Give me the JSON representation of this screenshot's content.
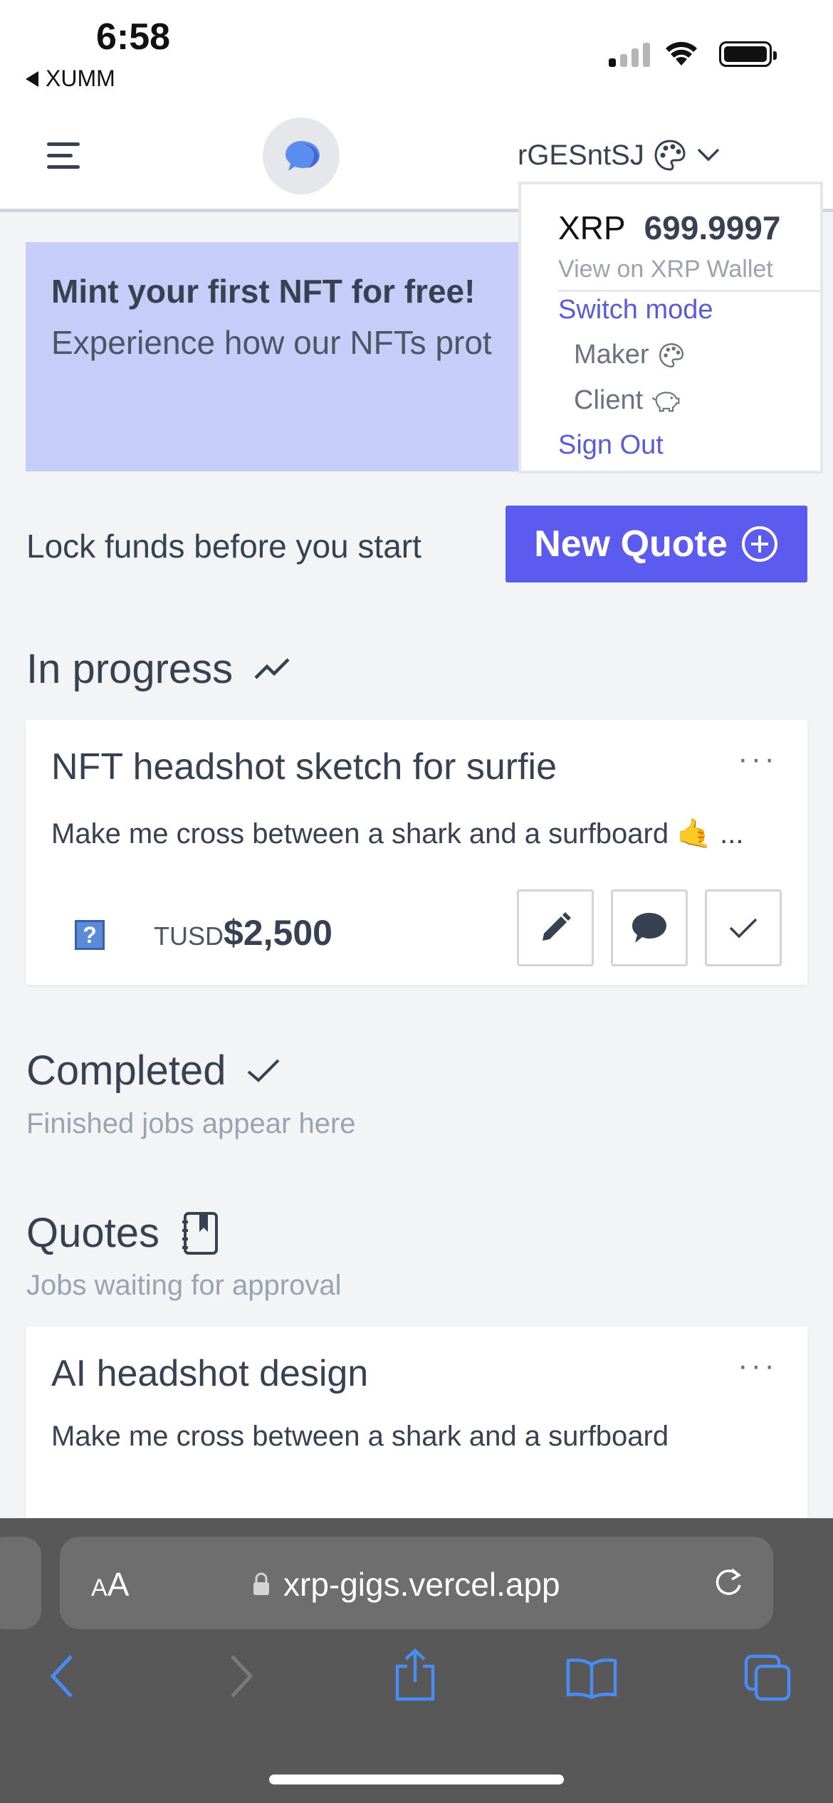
{
  "status": {
    "time": "6:58",
    "back_app": "XUMM"
  },
  "header": {
    "account": "rGESntSJ"
  },
  "dropdown": {
    "currency": "XRP",
    "balance": "699.9997",
    "view_link": "View on XRP Wallet",
    "switch_mode": "Switch mode",
    "maker": "Maker",
    "client": "Client",
    "sign_out": "Sign Out"
  },
  "banner": {
    "title": "Mint your first NFT for free!",
    "body": "Experience how our NFTs prot"
  },
  "lock": {
    "text": "Lock funds before you start",
    "new_quote": "New Quote"
  },
  "in_progress": {
    "title": "In progress",
    "card": {
      "title": "NFT headshot sketch for surfie",
      "more": "···",
      "desc": "Make me cross between a shark and a surfboard 🤙 ...",
      "currency": "TUSD",
      "amount": "$2,500"
    }
  },
  "completed": {
    "title": "Completed",
    "subtitle": "Finished jobs appear here"
  },
  "quotes": {
    "title": "Quotes",
    "subtitle": "Jobs waiting for approval",
    "card": {
      "title": "AI headshot design",
      "more": "···",
      "desc": "Make me cross between a shark and a surfboard"
    }
  },
  "safari": {
    "aa_small": "A",
    "aa_big": "A",
    "url": "xrp-gigs.vercel.app"
  },
  "colors": {
    "accent": "#5b5bf0",
    "banner": "#c7cdf9",
    "link": "#5b5bd6"
  }
}
